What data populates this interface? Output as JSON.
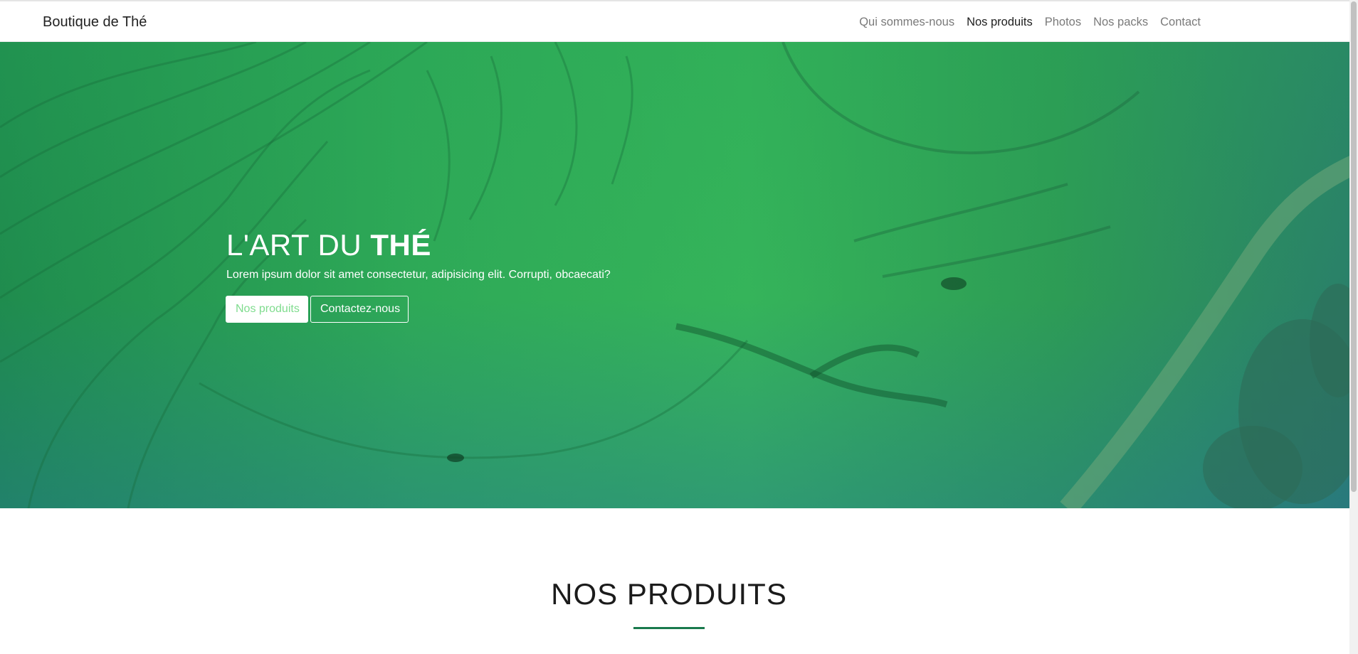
{
  "navbar": {
    "brand": "Boutique de Thé",
    "links": [
      {
        "label": "Qui sommes-nous",
        "active": false
      },
      {
        "label": "Nos produits",
        "active": true
      },
      {
        "label": "Photos",
        "active": false
      },
      {
        "label": "Nos packs",
        "active": false
      },
      {
        "label": "Contact",
        "active": false
      }
    ]
  },
  "hero": {
    "title_light": "L'ART DU ",
    "title_bold": "THÉ",
    "subtitle": "Lorem ipsum dolor sit amet consectetur, adipisicing elit. Corrupti, obcaecati?",
    "buttons": [
      {
        "label": "Nos produits"
      },
      {
        "label": "Contactez-nous"
      }
    ],
    "background": "rice-terrace-image"
  },
  "section": {
    "title": "NOS PRODUITS"
  },
  "colors": {
    "accent": "#1a7a4d",
    "hero_green": "#2ea957",
    "button_text": "#7fdc8e"
  }
}
